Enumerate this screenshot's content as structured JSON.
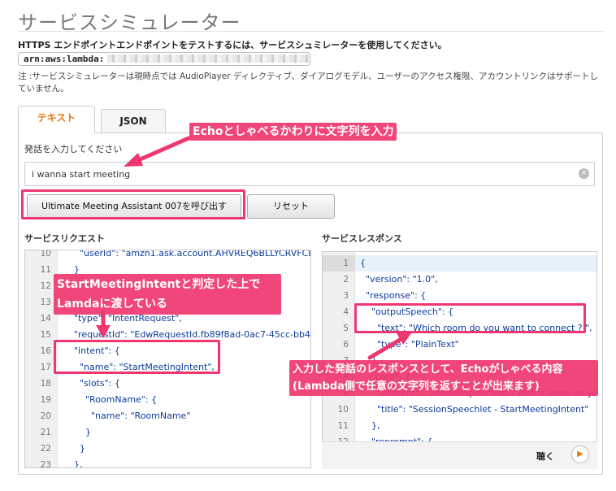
{
  "page": {
    "title": "サービスシミュレーター",
    "subtitle": "HTTPS エンドポイントエンドポイントをテストするには、サービスシュミレーターを使用してください。",
    "arn_prefix": "arn:aws:lambda:",
    "note": "注 :サービスシミュレーターは現時点では AudioPlayer ディレクティブ、ダイアログモデル、ユーザーのアクセス権限、アカウントリンクはサポートしていません。"
  },
  "tabs": [
    {
      "label": "テキスト",
      "active": true
    },
    {
      "label": "JSON",
      "active": false
    }
  ],
  "input": {
    "label": "発話を入力してください",
    "value": "i wanna start meeting",
    "clear_icon": "×"
  },
  "buttons": {
    "invoke": "Ultimate Meeting Assistant 007を呼び出す",
    "reset": "リセット"
  },
  "request": {
    "label": "サービスリクエスト",
    "lines": [
      {
        "n": "10",
        "code": "      \"userId\": \"amzn1.ask.account.AHVREQ6BLLYCRVFCB3G"
      },
      {
        "n": "11",
        "code": "    }"
      },
      {
        "n": "12",
        "code": "  },"
      },
      {
        "n": "13",
        "code": "  \"request\": {"
      },
      {
        "n": "14",
        "code": "    \"type\": \"IntentRequest\","
      },
      {
        "n": "15",
        "code": "    \"requestId\": \"EdwRequestId.fb89f8ad-0ac7-45cc-bb47-"
      },
      {
        "n": "16",
        "code": "    \"intent\": {"
      },
      {
        "n": "17",
        "code": "      \"name\": \"StartMeetingIntent\","
      },
      {
        "n": "18",
        "code": "      \"slots\": {"
      },
      {
        "n": "19",
        "code": "        \"RoomName\": {"
      },
      {
        "n": "20",
        "code": "          \"name\": \"RoomName\""
      },
      {
        "n": "21",
        "code": "        }"
      },
      {
        "n": "22",
        "code": "      }"
      },
      {
        "n": "23",
        "code": "    },"
      }
    ]
  },
  "response": {
    "label": "サービスレスポンス",
    "lines": [
      {
        "n": "1",
        "code": "{"
      },
      {
        "n": "2",
        "code": "  \"version\": \"1.0\","
      },
      {
        "n": "3",
        "code": "  \"response\": {"
      },
      {
        "n": "4",
        "code": "    \"outputSpeech\": {"
      },
      {
        "n": "5",
        "code": "      \"text\": \"Which room do you want to connect ? \","
      },
      {
        "n": "6",
        "code": "      \"type\": \"PlainText\""
      },
      {
        "n": "7",
        "code": "    },"
      },
      {
        "n": "8",
        "code": "    \"card\": {"
      },
      {
        "n": "9",
        "code": "      \"content\": \"SessionSpeechlet - Which room do you w"
      },
      {
        "n": "10",
        "code": "      \"title\": \"SessionSpeechlet - StartMeetingIntent\""
      },
      {
        "n": "11",
        "code": "    },"
      },
      {
        "n": "12",
        "code": "    \"reprompt\": {"
      }
    ],
    "listen_label": "聴く",
    "play_icon": "▶"
  },
  "annotations": {
    "input_hint": "Echoとしゃべるかわりに文字列を入力",
    "intent_note": "StartMeetingIntentと判定した上でLamdaに渡している",
    "response_note": "入力した発話のレスポンスとして、Echoがしゃべる内容(Lambda側で任意の文字列を返すことが出来ます)"
  },
  "colors": {
    "accent": "#e47911",
    "annotation": "#f0366f",
    "code": "#0b3b9e"
  }
}
